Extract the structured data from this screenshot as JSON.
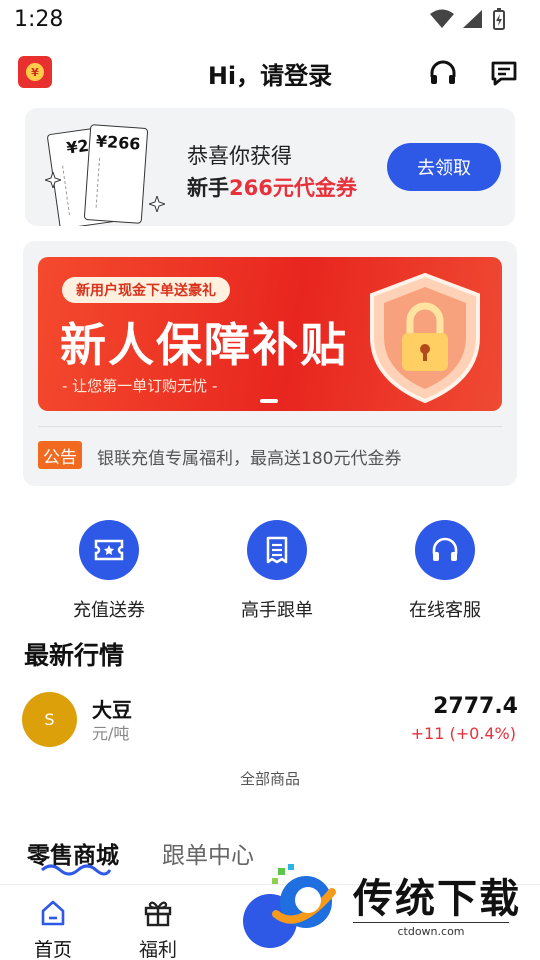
{
  "status_bar": {
    "time": "1:28"
  },
  "header": {
    "title": "Hi，请登录",
    "logo_glyph": "¥"
  },
  "coupon": {
    "ticket_front": "¥266",
    "ticket_back": "¥2",
    "line1": "恭喜你获得",
    "line2_prefix": "新手",
    "line2_highlight": "266元代金券",
    "claim_button": "去领取"
  },
  "banner": {
    "tag": "新用户现金下单送豪礼",
    "headline": "新人保障补贴",
    "subline": "- 让您第一单订购无忧 -"
  },
  "notice": {
    "tag": "公告",
    "text": "银联充值专属福利，最高送180元代金券"
  },
  "quick_actions": [
    {
      "label": "充值送券",
      "icon": "ticket-icon"
    },
    {
      "label": "高手跟单",
      "icon": "receipt-icon"
    },
    {
      "label": "在线客服",
      "icon": "headset-icon"
    }
  ],
  "market": {
    "title": "最新行情",
    "items": [
      {
        "avatar": "S",
        "name": "大豆",
        "unit": "元/吨",
        "price": "2777.4",
        "change": "+11 (+0.4%)"
      }
    ],
    "all_goods": "全部商品"
  },
  "tabs": [
    {
      "label": "零售商城"
    },
    {
      "label": "跟单中心"
    }
  ],
  "bottom_nav": [
    {
      "label": "首页",
      "icon": "home-icon"
    },
    {
      "label": "福利",
      "icon": "gift-icon"
    }
  ],
  "watermark": {
    "text": "传统下载",
    "url": "ctdown.com"
  },
  "colors": {
    "accent": "#2e58e6",
    "red": "#e8313b",
    "orange": "#f26a1f",
    "soybean": "#dca10a"
  }
}
